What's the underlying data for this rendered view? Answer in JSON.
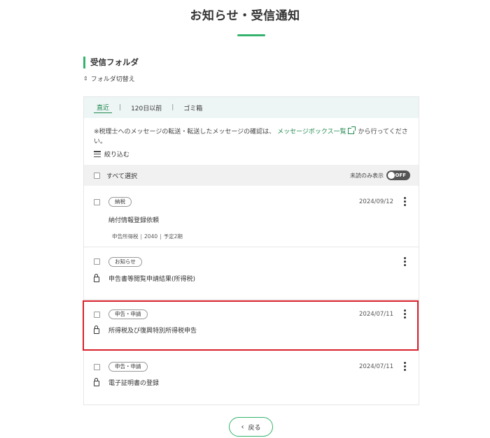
{
  "page": {
    "title": "お知らせ・受信通知"
  },
  "folder": {
    "heading": "受信フォルダ",
    "switch_label": "フォルダ切替え"
  },
  "tabs": [
    {
      "label": "直近",
      "active": true
    },
    {
      "label": "120日以前",
      "active": false
    },
    {
      "label": "ゴミ箱",
      "active": false
    }
  ],
  "tab_separator": "|",
  "notice": {
    "text_before": "※税理士へのメッセージの転送・転送したメッセージの確認は、",
    "link": "メッセージボックス一覧",
    "text_after": "から行ってください。"
  },
  "filter": {
    "label": "絞り込む"
  },
  "select_all": {
    "label": "すべて選択",
    "unread_only_label": "未読のみ表示",
    "toggle_state": "OFF"
  },
  "messages": [
    {
      "tag": "納税",
      "date": "2024/09/12",
      "subject": "納付情報登録依頼",
      "meta": [
        "申告所得税",
        "2040",
        "予定2期"
      ],
      "locked": false
    },
    {
      "tag": "お知らせ",
      "date": "",
      "subject": "申告書等閲覧申請結果(所得税)",
      "locked": true
    },
    {
      "tag": "申告・申請",
      "date": "2024/07/11",
      "subject": "所得税及び復興特別所得税申告",
      "locked": true,
      "highlighted": true
    },
    {
      "tag": "申告・申請",
      "date": "2024/07/11",
      "subject": "電子証明書の登録",
      "locked": true
    }
  ],
  "back_button": {
    "label": "戻る"
  },
  "colors": {
    "accent": "#35b36e",
    "link": "#238a51",
    "highlight": "#d7202a",
    "tab_bar": "#eef5f5"
  }
}
